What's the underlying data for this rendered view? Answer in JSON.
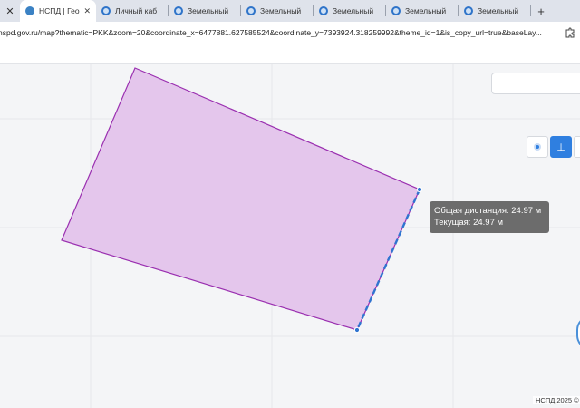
{
  "browser": {
    "tabs": [
      {
        "label": "НСПД | Гео",
        "favicon": "nspd-logo-icon",
        "active": true
      },
      {
        "label": "Личный каб",
        "favicon": "globe-icon",
        "active": false
      },
      {
        "label": "Земельный",
        "favicon": "globe-icon",
        "active": false
      },
      {
        "label": "Земельный",
        "favicon": "globe-icon",
        "active": false
      },
      {
        "label": "Земельный",
        "favicon": "globe-icon",
        "active": false
      },
      {
        "label": "Земельный",
        "favicon": "globe-icon",
        "active": false
      },
      {
        "label": "Земельный",
        "favicon": "globe-icon",
        "active": false
      }
    ],
    "close_symbol": "✕",
    "new_tab_symbol": "+",
    "url": "nspd.gov.ru/map?thematic=PKK&zoom=20&coordinate_x=6477881.627585524&coordinate_y=7393924.318259992&theme_id=1&is_copy_url=true&baseLay..."
  },
  "map": {
    "tooltip": {
      "total_distance": "Общая дистанция: 24.97 м",
      "current": "Текущая: 24.97 м"
    },
    "copyright": "НСПД 2025 ©",
    "parcel_fill": "#e4c6ec",
    "parcel_stroke": "#9a2fb0",
    "measure_color": "#2f74d0",
    "tool_symbols": {
      "point": "•",
      "angle": "⊥",
      "more": "▾"
    }
  }
}
